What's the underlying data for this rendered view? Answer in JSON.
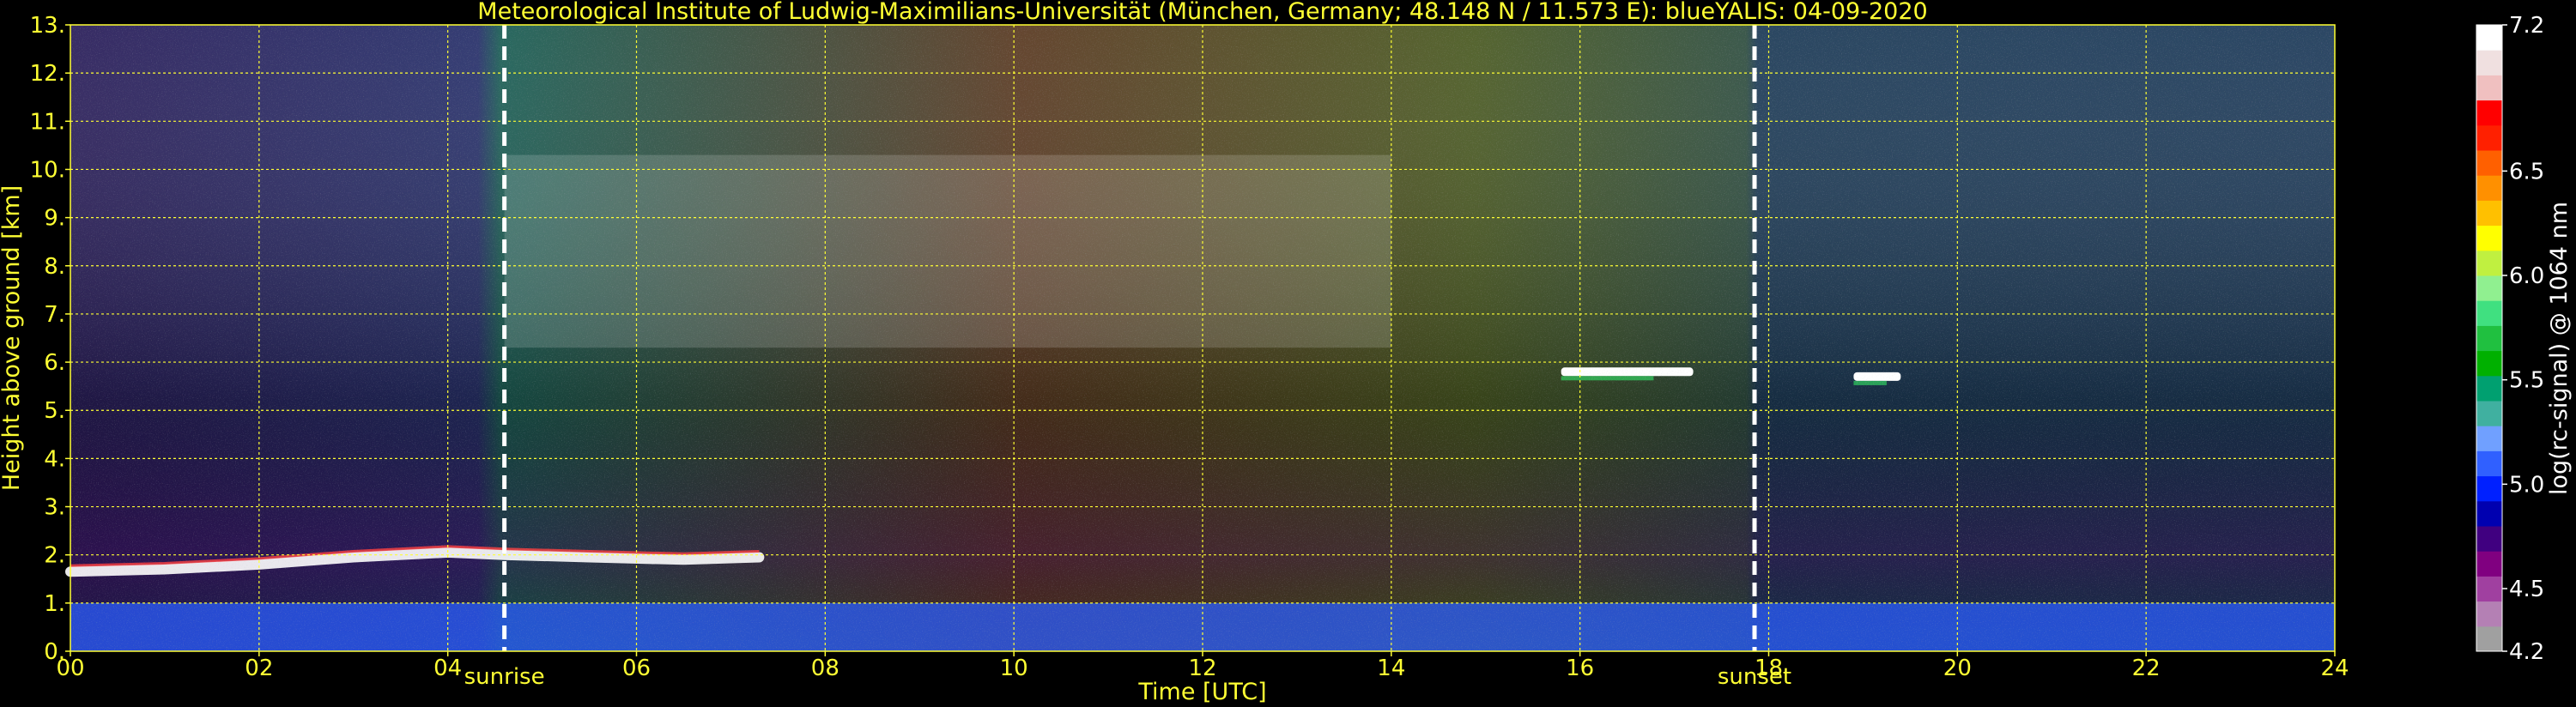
{
  "chart_data": {
    "type": "heatmap",
    "title": "Meteorological Institute of Ludwig-Maximilians-Universität (München, Germany; 48.148 N / 11.573 E):     blueYALIS: 04-09-2020",
    "xlabel": "Time [UTC]",
    "ylabel": "Height above ground [km]",
    "xlim": [
      0,
      24
    ],
    "ylim": [
      0,
      13
    ],
    "x_ticks": [
      "00",
      "02",
      "04",
      "06",
      "08",
      "10",
      "12",
      "14",
      "16",
      "18",
      "20",
      "22",
      "24"
    ],
    "y_ticks": [
      "0.",
      "1.",
      "2.",
      "3.",
      "4.",
      "5.",
      "6.",
      "7.",
      "8.",
      "9.",
      "10.",
      "11.",
      "12.",
      "13."
    ],
    "grid": true,
    "annotations": [
      {
        "label": "sunrise",
        "x": 4.6
      },
      {
        "label": "sunset",
        "x": 17.85
      }
    ],
    "colorbar": {
      "label": "log(rc-signal) @ 1064 nm",
      "range": [
        4.2,
        7.2
      ],
      "ticks": [
        "7.2",
        "6.5",
        "6.0",
        "5.5",
        "5.0",
        "4.5",
        "4.2"
      ],
      "tick_values": [
        7.2,
        6.5,
        6.0,
        5.5,
        5.0,
        4.5,
        4.2
      ],
      "colors": [
        "#a0a0a0",
        "#b480b4",
        "#a040a0",
        "#800080",
        "#400080",
        "#0000b0",
        "#0020ff",
        "#3060ff",
        "#70a0ff",
        "#40b0a0",
        "#00a070",
        "#00b000",
        "#20c040",
        "#40e080",
        "#90f090",
        "#c0f040",
        "#ffff00",
        "#ffc000",
        "#ff9000",
        "#ff6000",
        "#ff2000",
        "#ff0000",
        "#f0c0c0",
        "#f0e0e0",
        "#ffffff"
      ]
    },
    "features": [
      {
        "name": "boundary layer top",
        "x": [
          0,
          1,
          2,
          3,
          4,
          4.6,
          5.5,
          6.5,
          7.3
        ],
        "y": [
          1.65,
          1.7,
          1.8,
          1.95,
          2.05,
          2.0,
          1.95,
          1.9,
          1.95
        ]
      },
      {
        "name": "cirrus clouds",
        "x_range": [
          4.6,
          14
        ],
        "y_range": [
          6.3,
          10.3
        ]
      },
      {
        "name": "mid-level cloud",
        "x_range": [
          15.8,
          17.2
        ],
        "y": 5.8
      },
      {
        "name": "mid-level cloud",
        "x_range": [
          18.9,
          19.4
        ],
        "y": 5.7
      },
      {
        "name": "near-ground layer",
        "x_range": [
          0,
          24
        ],
        "y_range": [
          0,
          1.0
        ]
      }
    ]
  }
}
